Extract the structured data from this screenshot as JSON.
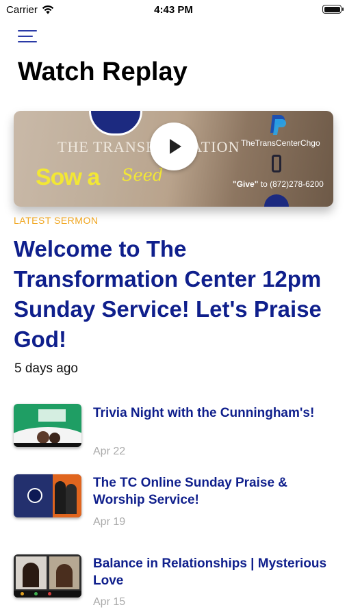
{
  "status_bar": {
    "carrier": "Carrier",
    "time": "4:43 PM"
  },
  "header": {
    "title": "Watch Replay"
  },
  "hero": {
    "brand": "THE TRANSFORMATION",
    "sow": "Sow a",
    "seed": "Seed",
    "handle": "TheTransCenterChgo",
    "give_word": "\"Give\"",
    "give_rest": " to (872)278-6200"
  },
  "featured": {
    "label": "LATEST SERMON",
    "title": "Welcome to The Transformation Center 12pm Sunday Service! Let's Praise God!",
    "date": "5 days ago"
  },
  "items": [
    {
      "title": "Trivia Night with the Cunningham's!",
      "date": "Apr 22"
    },
    {
      "title": "The TC Online Sunday Praise & Worship Service!",
      "date": "Apr 19"
    },
    {
      "title": "Balance in Relationships | Mysterious Love",
      "date": "Apr 15"
    }
  ],
  "colors": {
    "accent": "#0f1f8c",
    "label": "#f0a51e",
    "date": "#aaaaaa"
  }
}
